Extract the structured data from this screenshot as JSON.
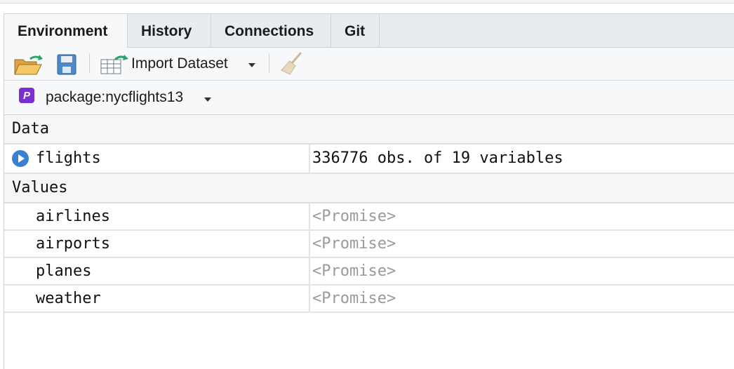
{
  "tabs": [
    "Environment",
    "History",
    "Connections",
    "Git"
  ],
  "toolbar": {
    "open_icon": "open-folder-icon",
    "save_icon": "save-icon",
    "import_label": "Import Dataset",
    "clear_icon": "broom-icon"
  },
  "env": {
    "badge": "P",
    "label": "package:nycflights13"
  },
  "sections": {
    "data": "Data",
    "values": "Values"
  },
  "data_rows": [
    {
      "name": "flights",
      "value": "336776 obs. of 19 variables"
    }
  ],
  "value_rows": [
    {
      "name": "airlines",
      "value": "<Promise>"
    },
    {
      "name": "airports",
      "value": "<Promise>"
    },
    {
      "name": "planes",
      "value": "<Promise>"
    },
    {
      "name": "weather",
      "value": "<Promise>"
    }
  ],
  "colors": {
    "accent": "#3a7fd0",
    "package_badge": "#7b2fd1",
    "promise_text": "#9a9a9a"
  }
}
